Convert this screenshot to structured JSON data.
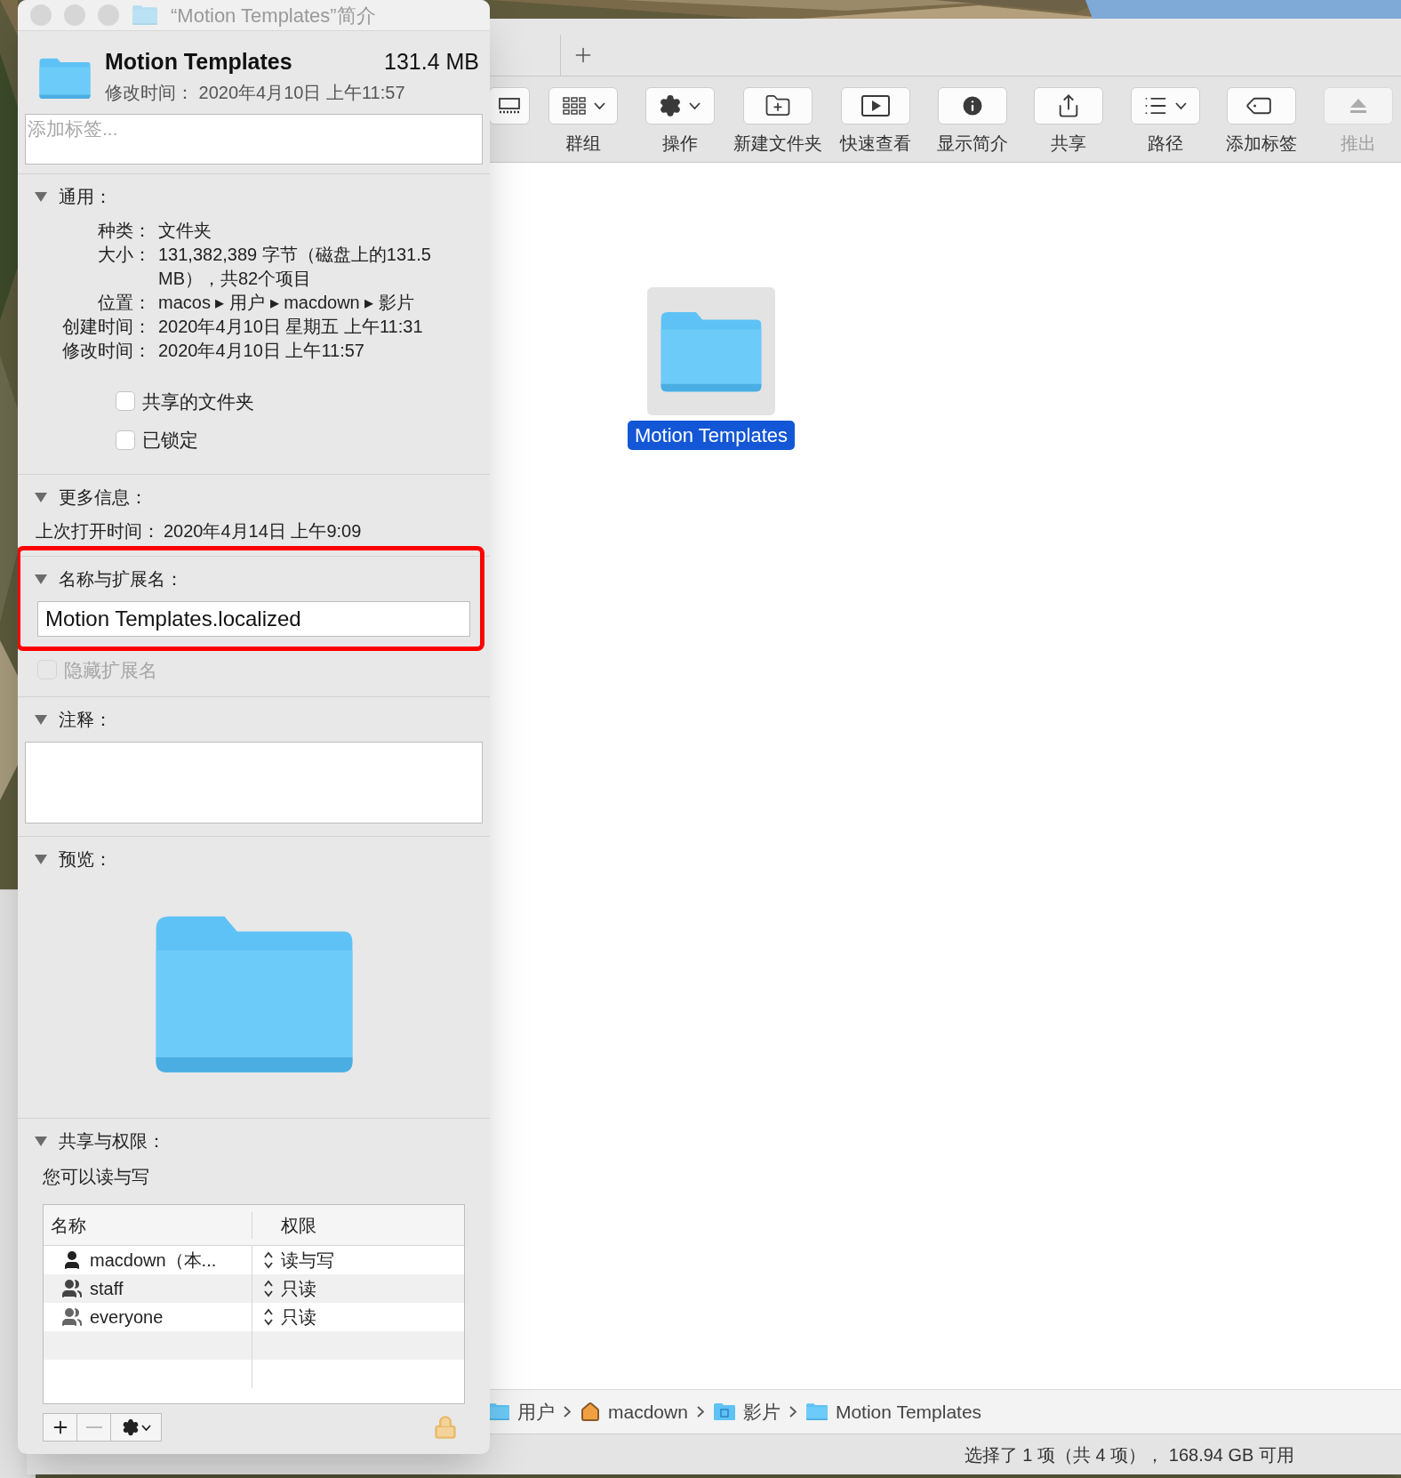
{
  "info_window": {
    "title": "“Motion Templates”简介",
    "name": "Motion Templates",
    "size": "131.4 MB",
    "modified": "修改时间： 2020年4月10日 上午11:57",
    "tags_placeholder": "添加标签...",
    "sections": [
      {
        "kind": "general",
        "title": "通用：",
        "expanded": true,
        "rows": [
          {
            "label": "种类：",
            "value": "文件夹"
          },
          {
            "label": "大小：",
            "value": "131,382,389 字节（磁盘上的131.5 MB），共82个项目"
          },
          {
            "label": "位置：",
            "value": "macos ▸ 用户 ▸ macdown ▸ 影片"
          },
          {
            "label": "创建时间：",
            "value": "2020年4月10日 星期五 上午11:31"
          },
          {
            "label": "修改时间：",
            "value": "2020年4月10日 上午11:57"
          }
        ],
        "checkboxes": [
          {
            "label": "共享的文件夹",
            "checked": false
          },
          {
            "label": "已锁定",
            "checked": false
          }
        ]
      },
      {
        "kind": "more",
        "title": "更多信息：",
        "expanded": true,
        "rows": [
          {
            "label": "上次打开时间：",
            "value": "2020年4月14日 上午9:09"
          }
        ]
      },
      {
        "kind": "name",
        "title": "名称与扩展名：",
        "expanded": true,
        "highlighted": true,
        "value": "Motion Templates.localized",
        "checkbox": {
          "label": "隐藏扩展名",
          "checked": false,
          "disabled": true
        }
      },
      {
        "kind": "comments",
        "title": "注释：",
        "expanded": true
      },
      {
        "kind": "preview",
        "title": "预览：",
        "expanded": true
      },
      {
        "kind": "permissions",
        "title": "共享与权限：",
        "expanded": true,
        "summary": "您可以读与写",
        "columns": [
          "名称",
          "权限"
        ],
        "rows": [
          {
            "name": "macdown（本...",
            "kind": "user",
            "privilege": "读与写"
          },
          {
            "name": "staff",
            "kind": "group",
            "privilege": "只读"
          },
          {
            "name": "everyone",
            "kind": "everyone",
            "privilege": "只读"
          }
        ]
      }
    ]
  },
  "finder": {
    "toolbar": [
      {
        "kind": "view",
        "dropdown": false,
        "disabled": false
      },
      {
        "kind": "group",
        "label": "群组",
        "dropdown": true,
        "disabled": false
      },
      {
        "kind": "action",
        "label": "操作",
        "dropdown": true,
        "disabled": false
      },
      {
        "kind": "new-folder",
        "label": "新建文件夹",
        "dropdown": false,
        "disabled": false
      },
      {
        "kind": "quick-look",
        "label": "快速查看",
        "dropdown": false,
        "disabled": false
      },
      {
        "kind": "info",
        "label": "显示简介",
        "dropdown": false,
        "disabled": false
      },
      {
        "kind": "share",
        "label": "共享",
        "dropdown": false,
        "disabled": false
      },
      {
        "kind": "path",
        "label": "路径",
        "dropdown": true,
        "disabled": false
      },
      {
        "kind": "tag",
        "label": "添加标签",
        "dropdown": false,
        "disabled": false
      },
      {
        "kind": "eject",
        "label": "推出",
        "dropdown": false,
        "disabled": true
      }
    ],
    "files": [
      {
        "name": "Motion Templates",
        "selected": true
      }
    ],
    "path": [
      {
        "label": "用户",
        "kind": "folder"
      },
      {
        "label": "macdown",
        "kind": "home"
      },
      {
        "label": "影片",
        "kind": "movies"
      },
      {
        "label": "Motion Templates",
        "kind": "folder"
      }
    ],
    "status": "选择了 1 项（共 4 项）， 168.94 GB 可用"
  }
}
